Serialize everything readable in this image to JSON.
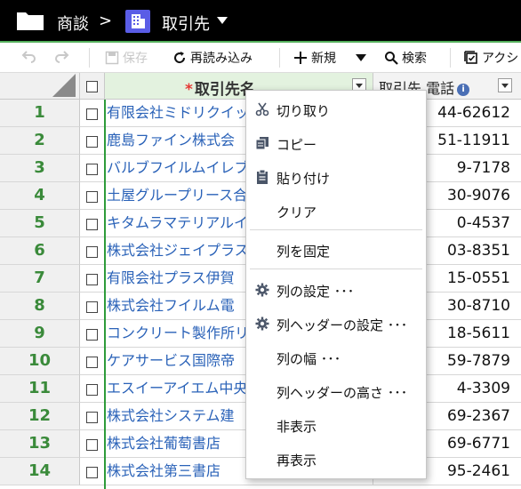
{
  "topbar": {
    "breadcrumb_parent": "商談",
    "separator": ">",
    "breadcrumb_current": "取引先",
    "accent_color": "#5a5de6"
  },
  "toolbar": {
    "save_label": "保存",
    "reload_label": "再読み込み",
    "new_label": "新規",
    "search_label": "検索",
    "action_label": "アクシ"
  },
  "grid": {
    "columns": [
      {
        "label": "取引先名",
        "required_mark": "*"
      },
      {
        "label": "取引先 電話"
      }
    ],
    "rows": [
      {
        "num": "1",
        "name": "有限会社ミドリクイッ",
        "phone": "44-62612"
      },
      {
        "num": "2",
        "name": "鹿島ファイン株式会",
        "phone": "51-11911"
      },
      {
        "num": "3",
        "name": "バルブフイルムイレブ",
        "phone": "9-7178"
      },
      {
        "num": "4",
        "name": "土屋グループリース合",
        "phone": "30-9076"
      },
      {
        "num": "5",
        "name": "キタムラマテリアルイレ",
        "phone": "0-4537"
      },
      {
        "num": "6",
        "name": "株式会社ジェイプラス",
        "phone": "03-8351"
      },
      {
        "num": "7",
        "name": "有限会社プラス伊賀",
        "phone": "15-0551"
      },
      {
        "num": "8",
        "name": "株式会社フイルム電",
        "phone": "30-8710"
      },
      {
        "num": "9",
        "name": "コンクリート製作所リ",
        "phone": "18-5611"
      },
      {
        "num": "10",
        "name": "ケアサービス国際帝",
        "phone": "59-7879"
      },
      {
        "num": "11",
        "name": "エスイーアイエム中央",
        "phone": "4-3309"
      },
      {
        "num": "12",
        "name": "株式会社システム建",
        "phone": "69-2367"
      },
      {
        "num": "13",
        "name": "株式会社葡萄書店",
        "phone": "69-6771"
      },
      {
        "num": "14",
        "name": "株式会社第三書店",
        "phone": "95-2461"
      }
    ]
  },
  "context_menu": {
    "items": [
      {
        "label": "切り取り",
        "icon": "scissors-icon"
      },
      {
        "label": "コピー",
        "icon": "copy-icon"
      },
      {
        "label": "貼り付け",
        "icon": "clipboard-icon"
      },
      {
        "label": "クリア",
        "icon": ""
      },
      {
        "label": "列を固定",
        "icon": ""
      },
      {
        "label": "列の設定 ･･･",
        "icon": "gear-icon"
      },
      {
        "label": "列ヘッダーの設定 ･･･",
        "icon": "gear-icon"
      },
      {
        "label": "列の幅 ･･･",
        "icon": ""
      },
      {
        "label": "列ヘッダーの高さ ･･･",
        "icon": ""
      },
      {
        "label": "非表示",
        "icon": ""
      },
      {
        "label": "再表示",
        "icon": ""
      }
    ]
  }
}
